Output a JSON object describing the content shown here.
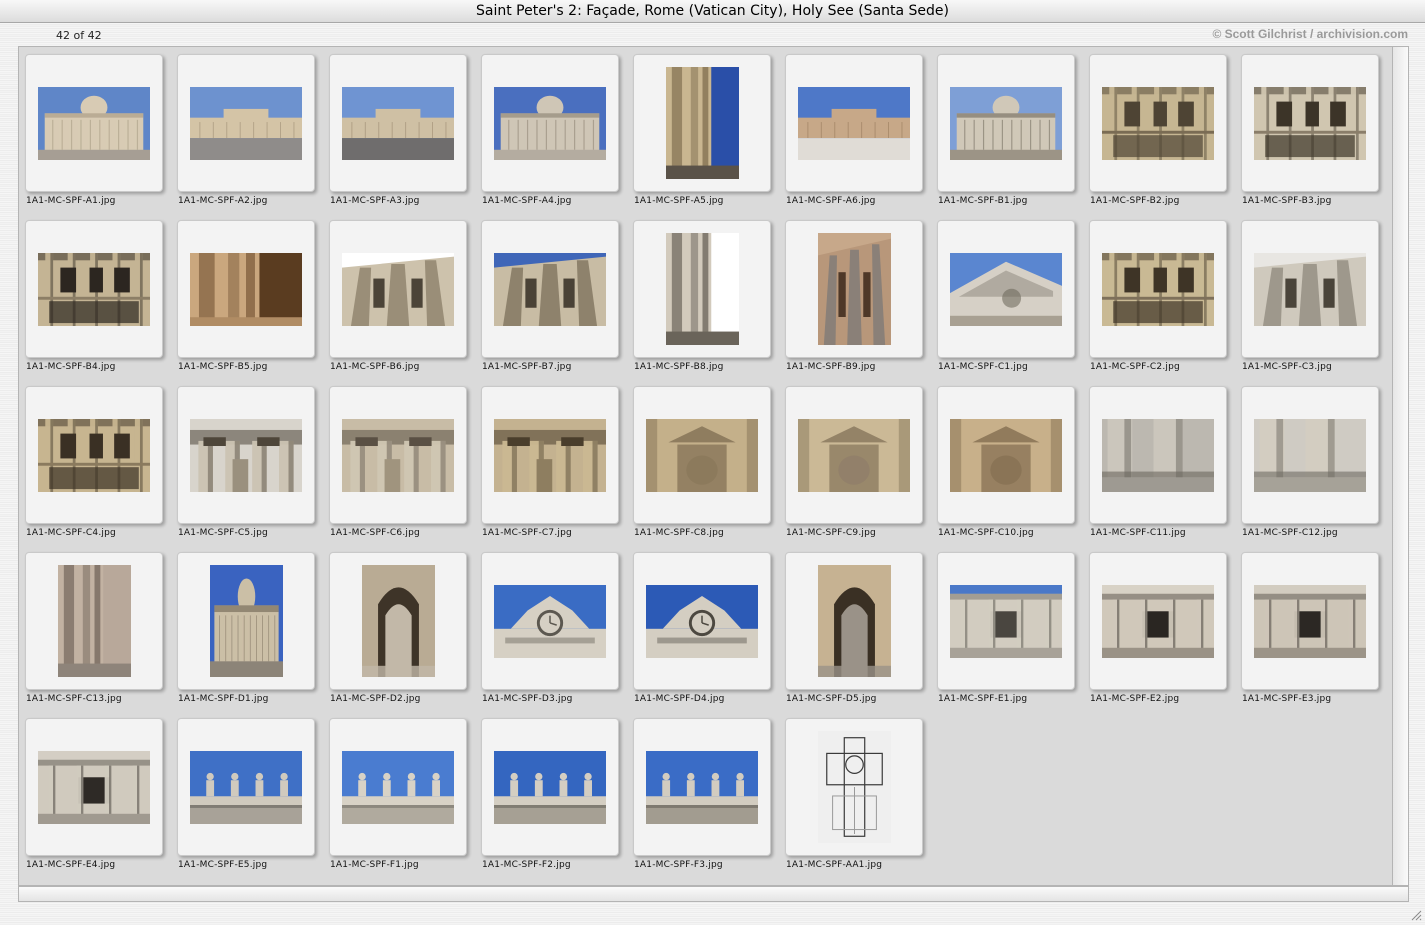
{
  "window": {
    "title": "Saint Peter's 2: Façade, Rome (Vatican City), Holy See (Santa Sede)"
  },
  "info": {
    "counter": "42 of 42",
    "credit": "© Scott Gilchrist / archivision.com"
  },
  "thumbnails": [
    {
      "file": "1A1-MC-SPF-A1.jpg",
      "orientation": "landscape",
      "sky": "#5f86c8",
      "stone": "#d8cbb4",
      "shade": "#9b8e76",
      "ground": "#a69e94",
      "style": "facade"
    },
    {
      "file": "1A1-MC-SPF-A2.jpg",
      "orientation": "landscape",
      "sky": "#6d92cf",
      "stone": "#d4c4a6",
      "shade": "#8e7e64",
      "ground": "#8f8c8a",
      "style": "square"
    },
    {
      "file": "1A1-MC-SPF-A3.jpg",
      "orientation": "landscape",
      "sky": "#6f94d2",
      "stone": "#cfc0a4",
      "shade": "#8b7b62",
      "ground": "#6f6d6d",
      "style": "square"
    },
    {
      "file": "1A1-MC-SPF-A4.jpg",
      "orientation": "landscape",
      "sky": "#4a6fbf",
      "stone": "#cfc6b6",
      "shade": "#7c7262",
      "ground": "#b4aca0",
      "style": "facade"
    },
    {
      "file": "1A1-MC-SPF-A5.jpg",
      "orientation": "portrait",
      "sky": "#2a4fa8",
      "stone": "#c9b690",
      "shade": "#6e5c40",
      "ground": "#5a5248",
      "style": "column"
    },
    {
      "file": "1A1-MC-SPF-A6.jpg",
      "orientation": "landscape",
      "sky": "#4e78c8",
      "stone": "#c7a888",
      "shade": "#8a6c50",
      "ground": "#e0dcd6",
      "style": "square"
    },
    {
      "file": "1A1-MC-SPF-B1.jpg",
      "orientation": "landscape",
      "sky": "#7e9fd6",
      "stone": "#d0c8b8",
      "shade": "#5c5448",
      "ground": "#9c9486",
      "style": "facade"
    },
    {
      "file": "1A1-MC-SPF-B2.jpg",
      "orientation": "landscape",
      "sky": "#b9a98c",
      "stone": "#c6b692",
      "shade": "#4e4434",
      "ground": "#7a6c54",
      "style": "windows"
    },
    {
      "file": "1A1-MC-SPF-B3.jpg",
      "orientation": "landscape",
      "sky": "#cfc8b8",
      "stone": "#d0c6b0",
      "shade": "#3c3428",
      "ground": "#8a7e6a",
      "style": "windows"
    },
    {
      "file": "1A1-MC-SPF-B4.jpg",
      "orientation": "landscape",
      "sky": "#cbbb9c",
      "stone": "#c4b494",
      "shade": "#2c2620",
      "ground": "#8c7e66",
      "style": "windows"
    },
    {
      "file": "1A1-MC-SPF-B5.jpg",
      "orientation": "landscape",
      "sky": "#5a3c20",
      "stone": "#caa77e",
      "shade": "#6a4a2c",
      "ground": "#b08c64",
      "style": "column"
    },
    {
      "file": "1A1-MC-SPF-B6.jpg",
      "orientation": "landscape",
      "sky": "#ffffff",
      "stone": "#cdc2ac",
      "shade": "#4c4438",
      "ground": "#9a8e78",
      "style": "columns-up"
    },
    {
      "file": "1A1-MC-SPF-B7.jpg",
      "orientation": "landscape",
      "sky": "#3f66b8",
      "stone": "#c8bca4",
      "shade": "#4a4236",
      "ground": "#8e826c",
      "style": "columns-up"
    },
    {
      "file": "1A1-MC-SPF-B8.jpg",
      "orientation": "portrait",
      "sky": "#ffffff",
      "stone": "#d2cabc",
      "shade": "#4e4840",
      "ground": "#6a645a",
      "style": "column"
    },
    {
      "file": "1A1-MC-SPF-B9.jpg",
      "orientation": "portrait",
      "sky": "#c7a88a",
      "stone": "#b8977a",
      "shade": "#4e3828",
      "ground": "#8a8078",
      "style": "columns-up"
    },
    {
      "file": "1A1-MC-SPF-C1.jpg",
      "orientation": "landscape",
      "sky": "#5a86d0",
      "stone": "#d6d0c6",
      "shade": "#6a6458",
      "ground": "#a8a092",
      "style": "pediment"
    },
    {
      "file": "1A1-MC-SPF-C2.jpg",
      "orientation": "landscape",
      "sky": "#c8b896",
      "stone": "#c9b994",
      "shade": "#3e3426",
      "ground": "#7e705a",
      "style": "windows"
    },
    {
      "file": "1A1-MC-SPF-C3.jpg",
      "orientation": "landscape",
      "sky": "#e8e6e2",
      "stone": "#cfc9bd",
      "shade": "#4a443a",
      "ground": "#9e988c",
      "style": "columns-up"
    },
    {
      "file": "1A1-MC-SPF-C4.jpg",
      "orientation": "landscape",
      "sky": "#b49c78",
      "stone": "#c7b590",
      "shade": "#3a3024",
      "ground": "#8a7a5e",
      "style": "windows"
    },
    {
      "file": "1A1-MC-SPF-C5.jpg",
      "orientation": "landscape",
      "sky": "#d8d4cc",
      "stone": "#cbc3b2",
      "shade": "#4e463a",
      "ground": "#9a907e",
      "style": "capitals"
    },
    {
      "file": "1A1-MC-SPF-C6.jpg",
      "orientation": "landscape",
      "sky": "#c8bca6",
      "stone": "#d0c6b2",
      "shade": "#5a5044",
      "ground": "#a0947e",
      "style": "capitals"
    },
    {
      "file": "1A1-MC-SPF-C7.jpg",
      "orientation": "landscape",
      "sky": "#c4b290",
      "stone": "#cab892",
      "shade": "#4a3e2c",
      "ground": "#8e7e60",
      "style": "capitals"
    },
    {
      "file": "1A1-MC-SPF-C8.jpg",
      "orientation": "landscape",
      "sky": "#c2b090",
      "stone": "#c4b08a",
      "shade": "#5a4a34",
      "ground": "#8c7a5c",
      "style": "niche"
    },
    {
      "file": "1A1-MC-SPF-C9.jpg",
      "orientation": "landscape",
      "sky": "#c6b496",
      "stone": "#cbb996",
      "shade": "#5e4e38",
      "ground": "#92806a",
      "style": "niche"
    },
    {
      "file": "1A1-MC-SPF-C10.jpg",
      "orientation": "landscape",
      "sky": "#c2a882",
      "stone": "#c8b08a",
      "shade": "#5a462e",
      "ground": "#8a7456",
      "style": "niche"
    },
    {
      "file": "1A1-MC-SPF-C11.jpg",
      "orientation": "landscape",
      "sky": "#bcb8b0",
      "stone": "#cbc6bc",
      "shade": "#6a665e",
      "ground": "#9e9a92",
      "style": "base"
    },
    {
      "file": "1A1-MC-SPF-C12.jpg",
      "orientation": "landscape",
      "sky": "#cfcbc3",
      "stone": "#d3cdc1",
      "shade": "#6e6a62",
      "ground": "#a6a298",
      "style": "base"
    },
    {
      "file": "1A1-MC-SPF-C13.jpg",
      "orientation": "portrait",
      "sky": "#b8a89a",
      "stone": "#c2b2a2",
      "shade": "#5e5248",
      "ground": "#8e847a",
      "style": "column"
    },
    {
      "file": "1A1-MC-SPF-D1.jpg",
      "orientation": "portrait",
      "sky": "#3a63c0",
      "stone": "#cbbfa6",
      "shade": "#5a5040",
      "ground": "#8c8478",
      "style": "facade"
    },
    {
      "file": "1A1-MC-SPF-D2.jpg",
      "orientation": "portrait",
      "sky": "#a89a86",
      "stone": "#b9ab94",
      "shade": "#3e3428",
      "ground": "#c2b8a8",
      "style": "arch"
    },
    {
      "file": "1A1-MC-SPF-D3.jpg",
      "orientation": "landscape",
      "sky": "#3a6cc4",
      "stone": "#d6d0c4",
      "shade": "#5c5850",
      "ground": "#a8a49a",
      "style": "clock"
    },
    {
      "file": "1A1-MC-SPF-D4.jpg",
      "orientation": "landscape",
      "sky": "#2c5ab6",
      "stone": "#d4cec2",
      "shade": "#4c4840",
      "ground": "#9c968a",
      "style": "clock"
    },
    {
      "file": "1A1-MC-SPF-D5.jpg",
      "orientation": "portrait",
      "sky": "#cdb894",
      "stone": "#c6b292",
      "shade": "#3a3024",
      "ground": "#9a9288",
      "style": "arch"
    },
    {
      "file": "1A1-MC-SPF-E1.jpg",
      "orientation": "landscape",
      "sky": "#4a78c8",
      "stone": "#d2ccc0",
      "shade": "#4a4640",
      "ground": "#a8a298",
      "style": "attic"
    },
    {
      "file": "1A1-MC-SPF-E2.jpg",
      "orientation": "landscape",
      "sky": "#d8d2c6",
      "stone": "#d0c8ba",
      "shade": "#2a2622",
      "ground": "#9a9286",
      "style": "attic"
    },
    {
      "file": "1A1-MC-SPF-E3.jpg",
      "orientation": "landscape",
      "sky": "#d2ccc0",
      "stone": "#cdc5b7",
      "shade": "#2c2824",
      "ground": "#9c9488",
      "style": "attic"
    },
    {
      "file": "1A1-MC-SPF-E4.jpg",
      "orientation": "landscape",
      "sky": "#d4cec4",
      "stone": "#d0cabe",
      "shade": "#2e2a26",
      "ground": "#a09a90",
      "style": "attic"
    },
    {
      "file": "1A1-MC-SPF-E5.jpg",
      "orientation": "landscape",
      "sky": "#3f70c6",
      "stone": "#d0cabe",
      "shade": "#5a5650",
      "ground": "#a8a298",
      "style": "statues"
    },
    {
      "file": "1A1-MC-SPF-F1.jpg",
      "orientation": "landscape",
      "sky": "#4a7cd0",
      "stone": "#d8d2c6",
      "shade": "#6a665e",
      "ground": "#b0aa9e",
      "style": "statues"
    },
    {
      "file": "1A1-MC-SPF-F2.jpg",
      "orientation": "landscape",
      "sky": "#3466c0",
      "stone": "#d4cec2",
      "shade": "#5c5850",
      "ground": "#a6a094",
      "style": "statues"
    },
    {
      "file": "1A1-MC-SPF-F3.jpg",
      "orientation": "landscape",
      "sky": "#3a6cc6",
      "stone": "#d2ccc0",
      "shade": "#5a564e",
      "ground": "#a29c90",
      "style": "statues"
    },
    {
      "file": "1A1-MC-SPF-AA1.jpg",
      "orientation": "portrait",
      "sky": "#efefef",
      "stone": "#9a9a9a",
      "shade": "#3a3a3a",
      "ground": "#d0d0d0",
      "style": "plan"
    }
  ]
}
